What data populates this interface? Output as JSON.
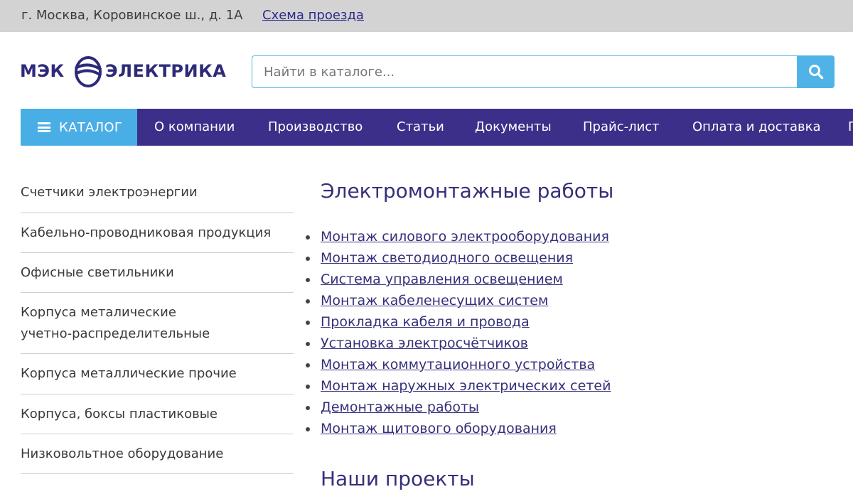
{
  "topbar": {
    "address": "г. Москва, Коровинское ш., д. 1А",
    "route_link": "Схема проезда"
  },
  "logo": {
    "word1": "МЭК",
    "word2": "ЭЛЕКТРИКА"
  },
  "search": {
    "placeholder": "Найти в каталоге..."
  },
  "nav": {
    "catalog_label": "КАТАЛОГ",
    "items": [
      "О компании",
      "Производство",
      "Статьи",
      "Документы",
      "Прайс-лист",
      "Оплата и доставка",
      "П"
    ]
  },
  "sidebar": {
    "items": [
      "Счетчики электроэнергии",
      "Кабельно-проводниковая продукция",
      "Офисные светильники",
      "Корпуса металические учетно-распределительные",
      "Корпуса металлические прочие",
      "Корпуса, боксы пластиковые",
      "Низковольтное оборудование"
    ]
  },
  "main": {
    "title": "Электромонтажные работы",
    "links": [
      "Монтаж силового электрооборудования",
      "Монтаж светодиодного освещения",
      "Система управления освещением",
      "Монтаж кабеленесущих систем",
      "Прокладка кабеля и провода",
      "Установка электросчётчиков",
      "Монтаж коммутационного устройства",
      "Монтаж наружных электрических сетей",
      "Демонтажные работы",
      "Монтаж щитового оборудования"
    ],
    "projects_title": "Наши проекты"
  },
  "colors": {
    "brand_dark": "#3b2f8a",
    "accent_blue": "#4aaee6",
    "link": "#35307a",
    "topbar_bg": "#d3d3d3"
  }
}
